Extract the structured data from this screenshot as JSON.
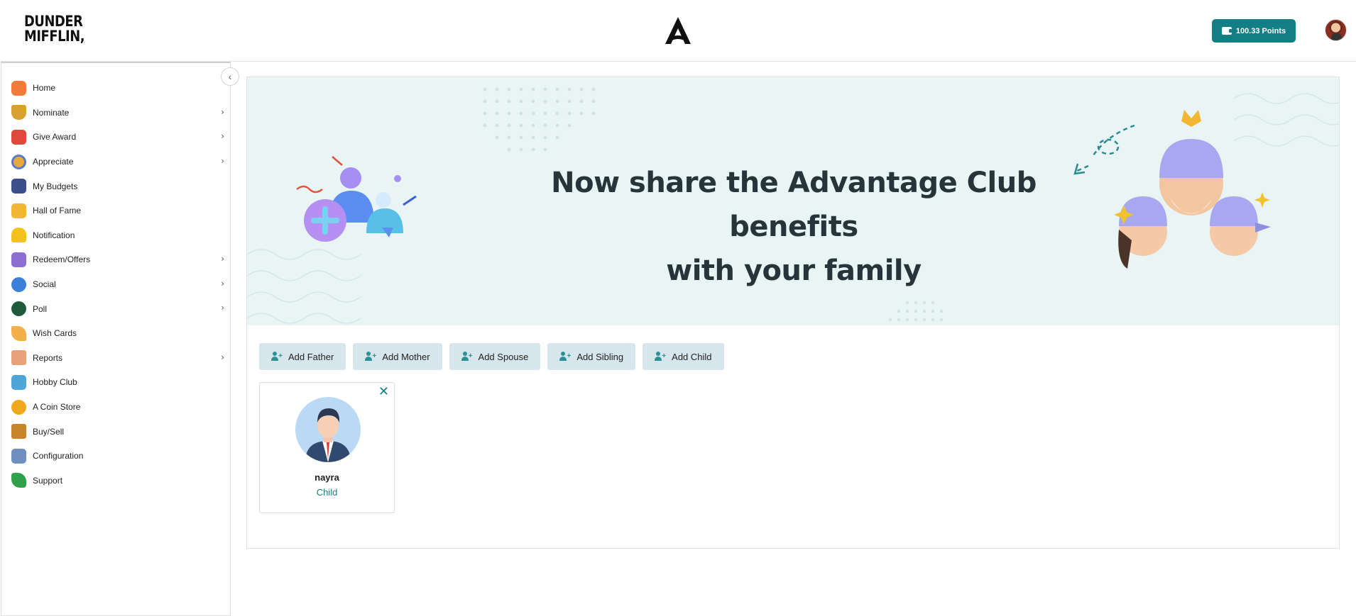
{
  "header": {
    "logo_line1": "DUNDER",
    "logo_line2": "MIFFLIN,",
    "points_label": "100.33  Points"
  },
  "sidebar": {
    "items": [
      {
        "label": "Home",
        "has_submenu": false,
        "icon": "home-icon"
      },
      {
        "label": "Nominate",
        "has_submenu": true,
        "icon": "trophy-icon"
      },
      {
        "label": "Give Award",
        "has_submenu": true,
        "icon": "gift-icon"
      },
      {
        "label": "Appreciate",
        "has_submenu": true,
        "icon": "medal-icon"
      },
      {
        "label": "My Budgets",
        "has_submenu": false,
        "icon": "wallet-icon"
      },
      {
        "label": "Hall of Fame",
        "has_submenu": false,
        "icon": "crown-icon"
      },
      {
        "label": "Notification",
        "has_submenu": false,
        "icon": "bell-icon"
      },
      {
        "label": "Redeem/Offers",
        "has_submenu": true,
        "icon": "voucher-icon"
      },
      {
        "label": "Social",
        "has_submenu": true,
        "icon": "chat-icon"
      },
      {
        "label": "Poll",
        "has_submenu": true,
        "icon": "poll-icon"
      },
      {
        "label": "Wish Cards",
        "has_submenu": false,
        "icon": "party-icon"
      },
      {
        "label": "Reports",
        "has_submenu": true,
        "icon": "clipboard-icon"
      },
      {
        "label": "Hobby Club",
        "has_submenu": false,
        "icon": "hobby-icon"
      },
      {
        "label": "A Coin Store",
        "has_submenu": false,
        "icon": "coin-icon"
      },
      {
        "label": "Buy/Sell",
        "has_submenu": false,
        "icon": "shopping-bags-icon"
      },
      {
        "label": "Configuration",
        "has_submenu": false,
        "icon": "settings-monitor-icon"
      },
      {
        "label": "Support",
        "has_submenu": false,
        "icon": "phone-icon"
      }
    ]
  },
  "banner": {
    "line1": "Now share the Advantage Club benefits",
    "line2": "with your family"
  },
  "actions": [
    {
      "label": "Add Father"
    },
    {
      "label": "Add Mother"
    },
    {
      "label": "Add Spouse"
    },
    {
      "label": "Add Sibling"
    },
    {
      "label": "Add Child"
    }
  ],
  "members": [
    {
      "name": "nayra",
      "relation": "Child"
    }
  ],
  "colors": {
    "accent": "#127f85",
    "banner_bg": "#e9f5f5",
    "action_bg": "#d7e6ec"
  }
}
